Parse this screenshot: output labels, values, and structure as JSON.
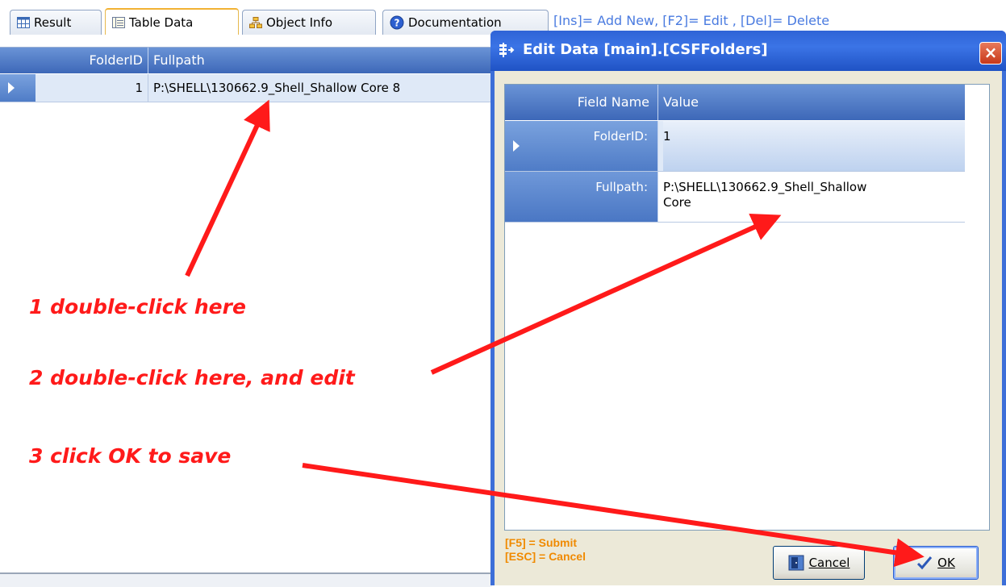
{
  "tabs": [
    {
      "label": "Result",
      "icon": "grid-icon"
    },
    {
      "label": "Table Data",
      "icon": "table-icon",
      "active": true
    },
    {
      "label": "Object Info",
      "icon": "hierarchy-icon"
    },
    {
      "label": "Documentation",
      "icon": "help-icon"
    }
  ],
  "shortcut_hint": "[Ins]= Add New, [F2]= Edit , [Del]= Delete",
  "grid": {
    "columns": [
      "FolderID",
      "Fullpath"
    ],
    "rows": [
      {
        "folder_id": "1",
        "fullpath": "P:\\SHELL\\130662.9_Shell_Shallow Core 8"
      }
    ]
  },
  "dialog": {
    "title": "Edit Data [main].[CSFFolders]",
    "close_label": "×",
    "columns": {
      "field_name": "Field Name",
      "value": "Value"
    },
    "fields": [
      {
        "name": "FolderID:",
        "value": "1"
      },
      {
        "name": "Fullpath:",
        "value_line1": "P:\\SHELL\\130662.9_Shell_Shallow",
        "value_line2": "Core"
      }
    ],
    "hint_submit": "[F5] = Submit",
    "hint_cancel": "[ESC] = Cancel",
    "cancel_label": "Cancel",
    "ok_label": "OK"
  },
  "annotations": {
    "step1": "1 double-click here",
    "step2": "2 double-click here, and edit",
    "step3": "3 click OK to save",
    "color": "#ff1a1a"
  },
  "colors": {
    "header_blue": "#3d68b8",
    "dialog_frame": "#3d6fd8",
    "hint_orange": "#f08a00",
    "link_blue": "#4a7be0"
  }
}
